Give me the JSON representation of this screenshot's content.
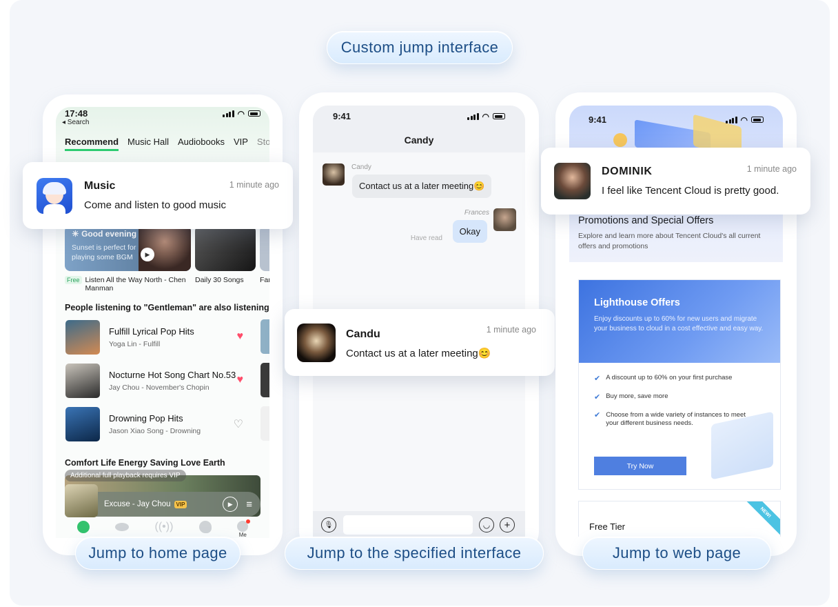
{
  "header": {
    "title": "Custom jump interface"
  },
  "labels": {
    "home": "Jump to home page",
    "specified": "Jump to the specified interface",
    "web": "Jump to web page"
  },
  "colors": {
    "accent": "#1d4e86",
    "pill": "#e2efff",
    "vip": "#f5c24a",
    "free_badge": "#34b86a",
    "heart": "#ff4d6a",
    "web_blue": "#4f7fe0"
  },
  "phone1": {
    "time": "17:48",
    "back": "◂ Search",
    "tabs": [
      "Recommend",
      "Music Hall",
      "Audiobooks",
      "VIP",
      "Stories"
    ],
    "card1": {
      "title": "☀ Good evening",
      "subtitle": "Sunset is perfect for playing some BGM"
    },
    "card2_caption": "Daily 30 Songs",
    "card3_caption": "Far",
    "free_badge": "Free",
    "playlist_title": "Listen All the Way North - Chen Manman",
    "section_title": "People listening to \"Gentleman\" are also listening to",
    "section_tag": "Fr",
    "songs": [
      {
        "title": "Fulfill Lyrical Pop Hits",
        "sub": "Yoga Lin - Fulfill"
      },
      {
        "title": "Nocturne Hot Song Chart No.53",
        "sub": "Jay Chou - November's Chopin"
      },
      {
        "title": "Drowning Pop Hits",
        "sub": "Jason Xiao Song - Drowning"
      }
    ],
    "section2_title": "Comfort Life Energy Saving Love Earth",
    "vip_tip": "Additional full playback requires VIP",
    "now_playing": "Excuse - Jay Chou",
    "vip_badge": "VIP",
    "nav_me": "Me",
    "notification": {
      "app": "Music",
      "time": "1 minute ago",
      "body": "Come and listen to good music"
    }
  },
  "phone2": {
    "time": "9:41",
    "title": "Candy",
    "msg1_sender": "Candy",
    "msg1_text": "Contact us at a later meeting😊",
    "msg2_sender": "Frances",
    "msg2_text": "Okay",
    "read_status": "Have read",
    "notification": {
      "sender": "Candu",
      "time": "1 minute ago",
      "body": "Contact us at a later meeting😊"
    }
  },
  "phone3": {
    "time": "9:41",
    "promo_title": "Promotions and Special Offers",
    "promo_desc": "Explore and learn more about Tencent Cloud's all current offers and promotions",
    "lighthouse_title": "Lighthouse Offers",
    "lighthouse_desc": "Enjoy discounts up to 60% for new users and migrate your business to cloud in a cost effective and easy way.",
    "checks": [
      "A discount up to 60% on your first purchase",
      "Buy more, save more",
      "Choose from a wide variety of instances to meet your different business needs."
    ],
    "cta": "Try Now",
    "free_tier": "Free Tier",
    "new_ribbon": "NEW!",
    "notification": {
      "sender": "DOMINIK",
      "time": "1 minute ago",
      "body": "I feel like Tencent Cloud is pretty good."
    }
  }
}
